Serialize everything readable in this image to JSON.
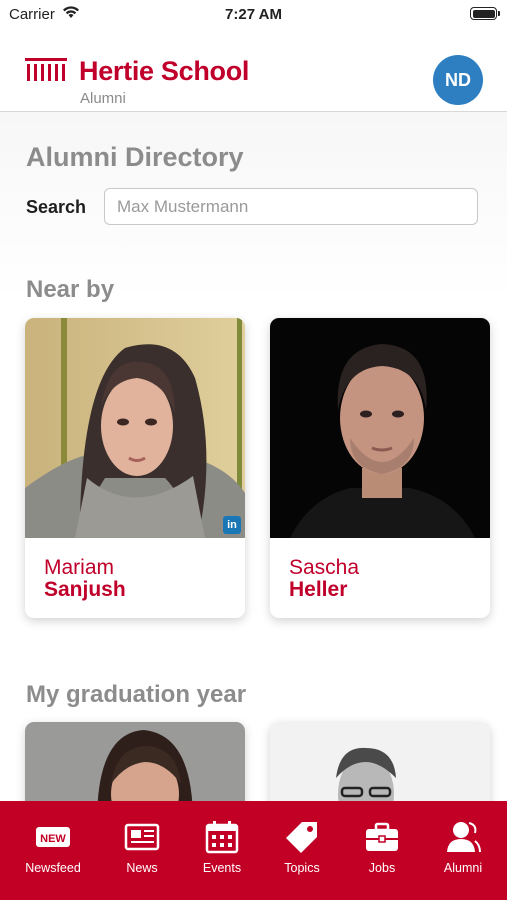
{
  "status_bar": {
    "carrier": "Carrier",
    "time": "7:27 AM"
  },
  "header": {
    "brand": "Hertie School",
    "subtitle": "Alumni",
    "avatar_initials": "ND"
  },
  "directory": {
    "title": "Alumni Directory",
    "search_label": "Search",
    "search_placeholder": "Max Mustermann",
    "search_value": ""
  },
  "nearby": {
    "title": "Near by",
    "people": [
      {
        "first": "Mariam",
        "last": "Sanjush",
        "linkedin": "in"
      },
      {
        "first": "Sascha",
        "last": "Heller"
      }
    ]
  },
  "graduation": {
    "title": "My graduation year"
  },
  "tabs": [
    {
      "label": "Newsfeed",
      "icon": "new-badge-icon",
      "icon_text": "NEW"
    },
    {
      "label": "News",
      "icon": "newspaper-icon"
    },
    {
      "label": "Events",
      "icon": "calendar-icon"
    },
    {
      "label": "Topics",
      "icon": "tag-icon"
    },
    {
      "label": "Jobs",
      "icon": "briefcase-icon"
    },
    {
      "label": "Alumni",
      "icon": "alumni-icon"
    }
  ],
  "colors": {
    "brand_red": "#c0002b",
    "tabbar_red": "#c20026",
    "avatar_blue": "#2e7fc2",
    "heading_gray": "#8c8c8c"
  }
}
